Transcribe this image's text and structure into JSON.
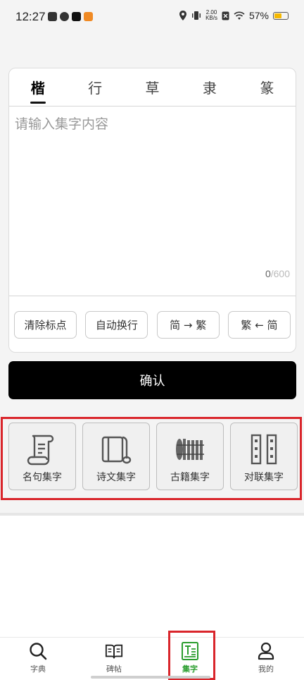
{
  "status_bar": {
    "time": "12:27",
    "network_speed_value": "2.00",
    "network_speed_unit": "KB/s",
    "battery": "57%",
    "battery_level": 0.57,
    "battery_color": "#f5b800"
  },
  "script_tabs": [
    {
      "label": "楷",
      "active": true
    },
    {
      "label": "行",
      "active": false
    },
    {
      "label": "草",
      "active": false
    },
    {
      "label": "隶",
      "active": false
    },
    {
      "label": "篆",
      "active": false
    }
  ],
  "input": {
    "placeholder": "请输入集字内容",
    "value": "",
    "count": "0",
    "separator": "/",
    "max": "600"
  },
  "tools": {
    "remove_punct": "清除标点",
    "auto_wrap": "自动换行",
    "to_traditional": "简 → 繁",
    "to_simplified": "繁 ← 简"
  },
  "confirm_label": "确认",
  "features": [
    {
      "label": "名句集字",
      "icon": "scroll-icon"
    },
    {
      "label": "诗文集字",
      "icon": "book-icon"
    },
    {
      "label": "古籍集字",
      "icon": "bamboo-slips-icon"
    },
    {
      "label": "对联集字",
      "icon": "couplet-icon"
    }
  ],
  "bottom_nav": [
    {
      "label": "字典",
      "icon": "search-icon",
      "active": false
    },
    {
      "label": "碑帖",
      "icon": "open-book-icon",
      "active": false
    },
    {
      "label": "集字",
      "icon": "collect-icon",
      "active": true
    },
    {
      "label": "我的",
      "icon": "user-icon",
      "active": false
    }
  ],
  "colors": {
    "accent_green": "#2a9d2e",
    "highlight_red": "#d9252b",
    "confirm_bg": "#000000"
  }
}
